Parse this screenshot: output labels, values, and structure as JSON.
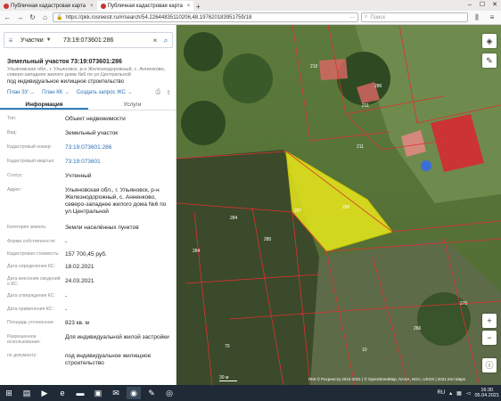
{
  "browser": {
    "tabs": [
      {
        "title": "Публичная кадастровая карта",
        "active": false
      },
      {
        "title": "Публичная кадастровая карта",
        "active": true
      }
    ],
    "url": "https://pkk.rosreestr.ru/#/search/54.22644835110206,48.19762018395175б/18",
    "search_placeholder": "Поиск"
  },
  "panel": {
    "search": {
      "category": "Участки",
      "query": "73:19:073601:286"
    },
    "title": "Земельный участок 73:19:073601:286",
    "address_short": "Ульяновская обл., г. Ульяновск, р-н Железнодорожный, с. Анненково, северо-западнее жилого дома №6 по ул.Центральной",
    "links": [
      "План ЗУ →",
      "План КК →",
      "Создать запрос ЖС →"
    ],
    "tabs": [
      "Информация",
      "Услуги"
    ],
    "fields": [
      {
        "label": "Тип:",
        "value": "Объект недвижимости"
      },
      {
        "label": "Вид:",
        "value": "Земельный участок"
      },
      {
        "label": "Кадастровый номер:",
        "value": "73:19:073601:286"
      },
      {
        "label": "Кадастровый квартал:",
        "value": "73:19:073601"
      },
      {
        "label": "Статус:",
        "value": "Учтенный"
      },
      {
        "label": "Адрес:",
        "value": "Ульяновская обл., г. Ульяновск, р-н Железнодорожный, с. Анненково, северо-западнее жилого дома №6 по ул.Центральной"
      },
      {
        "label": "Категория земель:",
        "value": "Земли населённых пунктов"
      },
      {
        "label": "Форма собственности:",
        "value": "-"
      },
      {
        "label": "Кадастровая стоимость:",
        "value": "157 700,45 руб."
      },
      {
        "label": "Дата определения КС:",
        "value": "18.02.2021"
      },
      {
        "label": "Дата внесения сведений о КС:",
        "value": "24.03.2021"
      },
      {
        "label": "Дата утверждения КС:",
        "value": "-"
      },
      {
        "label": "Дата применения КС:",
        "value": "-"
      },
      {
        "label": "Площадь уточненная:",
        "value": "823 кв. м"
      },
      {
        "label": "Разрешенное использование:",
        "value": "Для индивидуальной жилой застройки"
      },
      {
        "label": "по документу:",
        "value": "под индивидуальное жилищное строительство"
      }
    ],
    "subtitle": "под индивидуальное жилищное строительство"
  },
  "map": {
    "parcel_labels": [
      "210",
      "286",
      "211",
      "211",
      "287",
      "284",
      "286",
      "285",
      "284",
      "70",
      "266",
      "275",
      "10"
    ],
    "attribution": "ПКК © Росреестр 2010-2021 | © OpenStreetMap, NASA, NGA, USGS | 2021 Esri Maps",
    "scale": "30 м",
    "highlight_color": "#e8e81a"
  },
  "taskbar": {
    "lang": "RU",
    "time": "16:30",
    "date": "05.04.2021"
  }
}
